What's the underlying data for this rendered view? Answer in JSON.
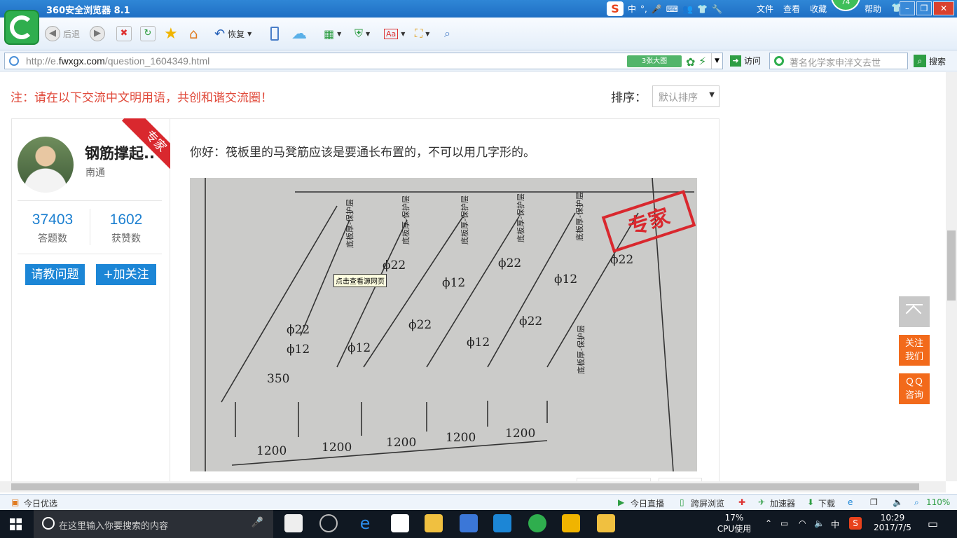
{
  "window": {
    "title": "360安全浏览器 8.1",
    "badge": "74"
  },
  "ime": {
    "mode": "中",
    "punct": "°,"
  },
  "menu": [
    "文件",
    "查看",
    "收藏",
    "帮助"
  ],
  "toolbar": {
    "back": "后退",
    "restore": "恢复"
  },
  "address": {
    "url_prefix": "http://e.",
    "url_domain": "fwxgx.com",
    "url_path": "/question_1604349.html",
    "big_image": "3张大图",
    "visit": "访问"
  },
  "search": {
    "placeholder": "著名化学家申泮文去世",
    "button": "搜索"
  },
  "page": {
    "note": "注：请在以下交流中文明用语，共创和谐交流圈！",
    "sort_label": "排序：",
    "sort_value": "默认排序"
  },
  "profile": {
    "name": "钢筋撑起..",
    "city": "南通",
    "ribbon": "专家",
    "answers": "37403",
    "answers_label": "答题数",
    "likes": "1602",
    "likes_label": "获赞数",
    "ask_button": "请教问题",
    "follow_button": "+加关注"
  },
  "answer": {
    "text": "你好：筏板里的马凳筋应该是要通长布置的，不可以用几字形的。",
    "tooltip": "点击查看源网页",
    "stamp": "专家",
    "drawing_labels": {
      "bar22": "ϕ22",
      "bar12": "ϕ12",
      "dim1200": "1200",
      "dim350": "350",
      "cover": "底板厚-保护层"
    }
  },
  "float": {
    "follow": "关注\n我们",
    "qq": "ＱＱ\n咨询"
  },
  "status": {
    "today_pick": "今日优选",
    "live": "今日直播",
    "cross_screen": "跨屏浏览",
    "accelerator": "加速器",
    "download": "下载",
    "zoom": "110%"
  },
  "taskbar": {
    "search_placeholder": "在这里输入你要搜索的内容",
    "cpu": "17%",
    "cpu_label": "CPU使用",
    "lang": "中",
    "time": "10:29",
    "date": "2017/7/5"
  }
}
